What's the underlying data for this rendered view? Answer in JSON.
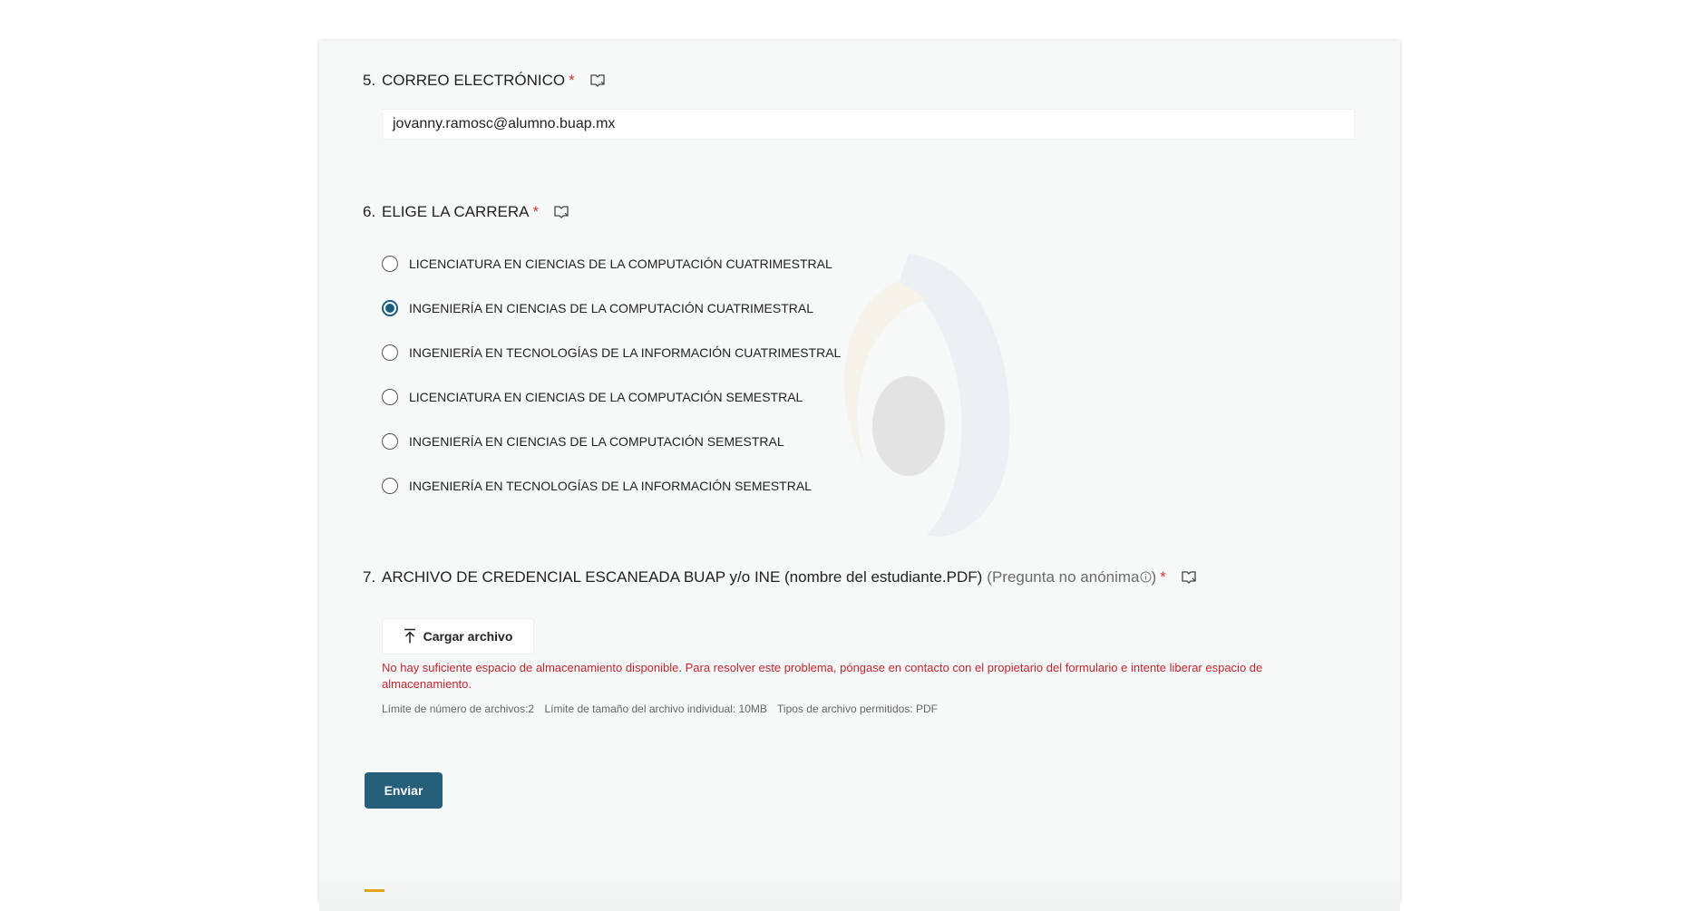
{
  "form": {
    "q5": {
      "number": "5.",
      "title": "CORREO ELECTRÓNICO",
      "required_mark": "*",
      "value": "jovanny.ramosc@alumno.buap.mx"
    },
    "q6": {
      "number": "6.",
      "title": "ELIGE LA CARRERA",
      "required_mark": "*",
      "options": [
        {
          "label": "LICENCIATURA EN CIENCIAS DE LA COMPUTACIÓN CUATRIMESTRAL",
          "checked": false
        },
        {
          "label": "INGENIERÍA EN CIENCIAS DE LA COMPUTACIÓN CUATRIMESTRAL",
          "checked": true
        },
        {
          "label": "INGENIERÍA EN TECNOLOGÍAS DE LA INFORMACIÓN CUATRIMESTRAL",
          "checked": false
        },
        {
          "label": "LICENCIATURA EN CIENCIAS DE LA COMPUTACIÓN SEMESTRAL",
          "checked": false
        },
        {
          "label": "INGENIERÍA EN CIENCIAS DE LA COMPUTACIÓN SEMESTRAL",
          "checked": false
        },
        {
          "label": "INGENIERÍA EN TECNOLOGÍAS DE LA INFORMACIÓN SEMESTRAL",
          "checked": false
        }
      ]
    },
    "q7": {
      "number": "7.",
      "title": "ARCHIVO DE CREDENCIAL ESCANEADA BUAP y/o INE (nombre del estudiante.PDF)",
      "note_open": "(Pregunta no anónima",
      "note_close": ")",
      "required_mark": "*",
      "upload_label": "Cargar archivo",
      "error": "No hay suficiente espacio de almacenamiento disponible. Para resolver este problema, póngase en contacto con el propietario del formulario e intente liberar espacio de almacenamiento.",
      "limit_count": "Límite de número de archivos:2",
      "limit_size": "Límite de tamaño del archivo individual: 10MB",
      "limit_types": "Tipos de archivo permitidos: PDF"
    },
    "submit_label": "Enviar"
  },
  "icons": {
    "reader": "immersive-reader-icon",
    "upload": "upload-arrow-icon",
    "info": "info-icon"
  },
  "colors": {
    "accent": "#255f7a",
    "radio_checked": "#1d5d7f",
    "required": "#d13438",
    "error": "#c4262e"
  }
}
